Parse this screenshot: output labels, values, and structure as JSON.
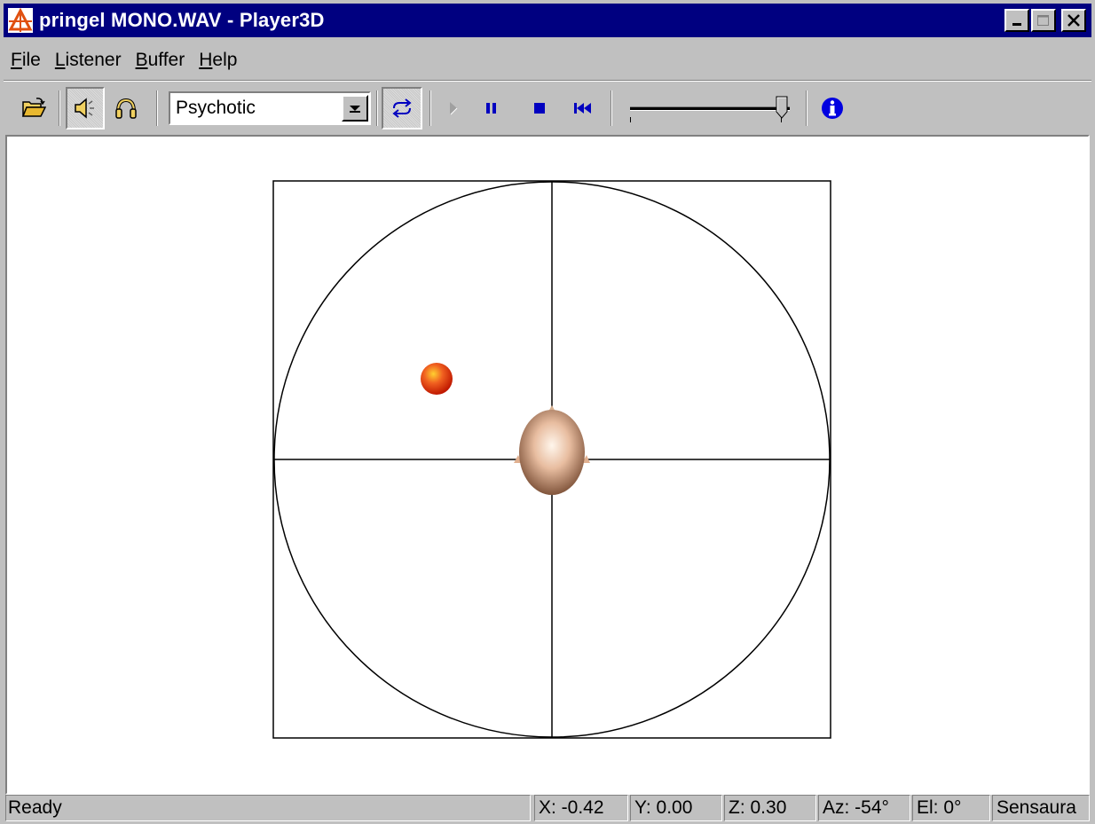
{
  "window": {
    "title": "pringel MONO.WAV - Player3D",
    "accent": "#000080"
  },
  "menu": {
    "items": [
      {
        "label": "File",
        "accel": "F",
        "rest": "ile"
      },
      {
        "label": "Listener",
        "accel": "L",
        "rest": "istener"
      },
      {
        "label": "Buffer",
        "accel": "B",
        "rest": "uffer"
      },
      {
        "label": "Help",
        "accel": "H",
        "rest": "elp"
      }
    ]
  },
  "toolbar": {
    "preset_selected": "Psychotic",
    "icons": [
      "folder-open-icon",
      "speaker-icon",
      "headphones-icon",
      "loop-icon",
      "play-icon",
      "pause-icon",
      "stop-icon",
      "rewind-icon",
      "info-icon"
    ],
    "volume_level": 0.95
  },
  "scene": {
    "listener_icon": "head-icon",
    "source_icon": "sound-source-ball-icon",
    "source_color": "#e8401c"
  },
  "status": {
    "ready": "Ready",
    "x": "X: -0.42",
    "y": "Y:  0.00",
    "z": "Z:  0.30",
    "az": "Az:  -54°",
    "el": "El:   0°",
    "engine": "Sensaura"
  }
}
